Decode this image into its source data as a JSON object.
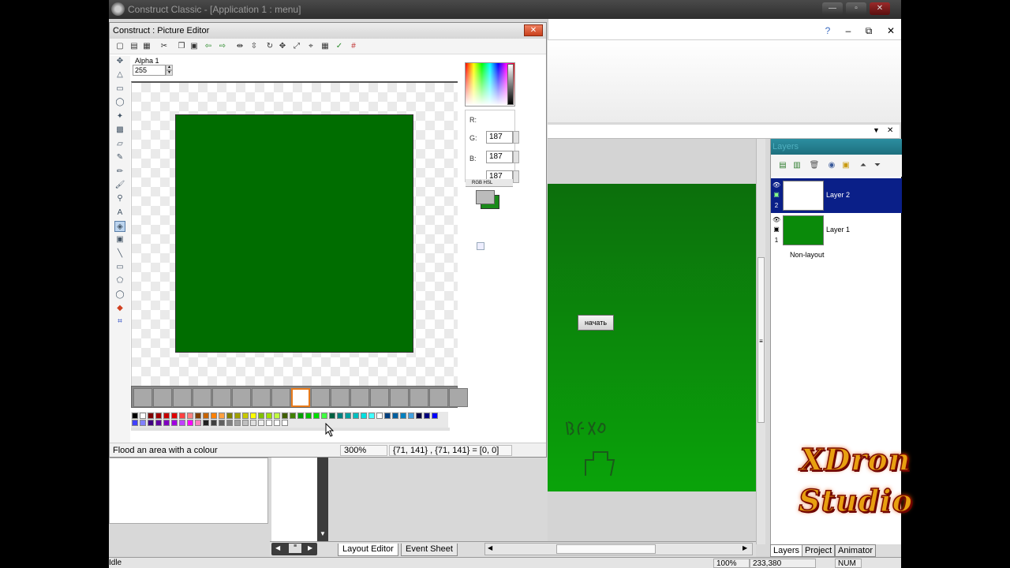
{
  "app": {
    "title": "Construct Classic - [Application 1 : menu]",
    "controls": {
      "minimize": "—",
      "maximize": "▫",
      "close": "✕"
    }
  },
  "ribbon": {
    "help": "?",
    "minimize": "–",
    "restore": "⧉",
    "close": "✕"
  },
  "layout_header": {
    "dropdown": "▼",
    "close": "✕"
  },
  "layout_editor": {
    "button_label": "начать",
    "canvas_color": "#0a8a0a"
  },
  "picture_editor": {
    "title": "Construct : Picture Editor",
    "close": "✕",
    "alpha_label": "Alpha 1",
    "alpha_value": "255",
    "status_text": "Flood an area with a colour",
    "zoom": "300%",
    "coords": "{71, 141} , {71, 141} = [0, 0]",
    "rgb": {
      "r_label": "R:",
      "g_label": "G:",
      "b_label": "B:",
      "g_value": "187",
      "b_value": "187",
      "a_value": "187"
    },
    "hex_tabs": "RGB    HSL",
    "image_color": "#006d00",
    "primary_color": "#bbbbbb",
    "secondary_color": "#1a8a1a",
    "palette": [
      "#000000",
      "#ffffff",
      "#7f0000",
      "#a00000",
      "#c80000",
      "#e00000",
      "#ff4040",
      "#ff8080",
      "#7f3f00",
      "#c86400",
      "#ff8000",
      "#ffa040",
      "#808000",
      "#a0a000",
      "#c8c800",
      "#ffff00",
      "#80c000",
      "#a0e000",
      "#c0ff40",
      "#406000",
      "#408000",
      "#00a000",
      "#00c000",
      "#00e000",
      "#40ff40",
      "#006040",
      "#008080",
      "#00a0a0",
      "#00c0c0",
      "#00e0e0",
      "#40ffff",
      "#ffffff",
      "#004080",
      "#0060a0",
      "#0080c0",
      "#40a0e0",
      "#000040",
      "#00007f",
      "#0000ff",
      "#4040ff",
      "#8080ff",
      "#400080",
      "#6000a0",
      "#8000c0",
      "#a000e0",
      "#c040ff",
      "#ff00ff",
      "#ff80c0",
      "#202020",
      "#404040",
      "#606060",
      "#808080",
      "#a0a0a0",
      "#c0c0c0",
      "#e0e0e0",
      "#f0f0f0",
      "#ffffff",
      "#ffffff",
      "#ffffff"
    ],
    "frame_count": 17,
    "active_frame": 8
  },
  "layers_panel": {
    "title": "Layers",
    "layers": [
      {
        "name": "Layer 2",
        "index": "2",
        "selected": true
      },
      {
        "name": "Layer 1",
        "index": "1",
        "selected": false
      }
    ],
    "non_layout": "Non-layout",
    "tabs": [
      "Layers",
      "Project",
      "Animator"
    ]
  },
  "bottom_tabs": {
    "layout_editor": "Layout Editor",
    "event_sheet": "Event Sheet"
  },
  "statusbar": {
    "text": "Idle",
    "zoom": "100%",
    "coords": "233,380",
    "num": "NUM"
  },
  "watermark": {
    "line1": "XDron",
    "line2": "Studio"
  }
}
